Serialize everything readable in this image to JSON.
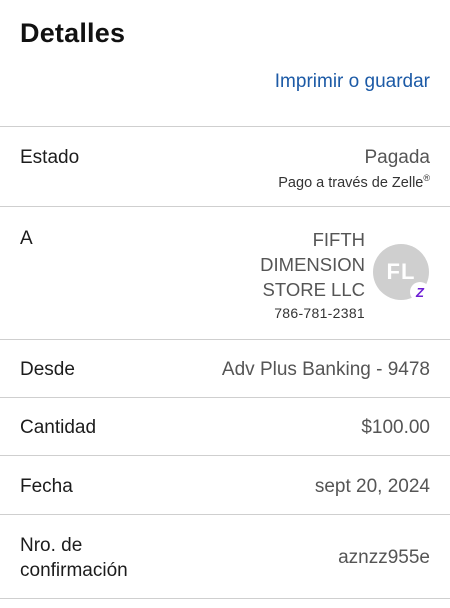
{
  "header": {
    "title": "Detalles",
    "print_link": "Imprimir o guardar"
  },
  "status": {
    "label": "Estado",
    "value": "Pagada",
    "sub": "Pago a través de Zelle",
    "sub_mark": "®"
  },
  "to": {
    "label": "A",
    "name": "FIFTH DIMENSION STORE LLC",
    "phone": "786-781-2381",
    "initials": "FL",
    "badge_icon": "zelle-icon",
    "badge_glyph": "Z"
  },
  "from": {
    "label": "Desde",
    "value": "Adv Plus Banking - 9478"
  },
  "amount": {
    "label": "Cantidad",
    "value": "$100.00"
  },
  "date": {
    "label": "Fecha",
    "value": "sept 20, 2024"
  },
  "confirmation": {
    "label_line1": "Nro. de",
    "label_line2": "confirmación",
    "value": "aznzz955e"
  },
  "colors": {
    "link": "#1c5aa6",
    "zelle": "#6d1ed4",
    "avatar_bg": "#cfcfcf",
    "divider": "#cfcfcf"
  }
}
